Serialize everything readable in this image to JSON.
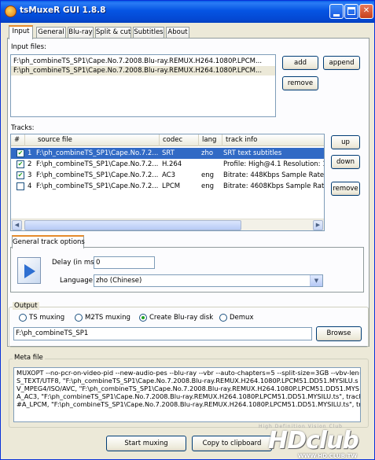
{
  "window": {
    "title": "tsMuxeR GUI 1.8.8"
  },
  "tabs": [
    "Input",
    "General",
    "Blu-ray",
    "Split & cut",
    "Subtitles",
    "About"
  ],
  "input_files": {
    "label": "Input files:",
    "files": [
      "F:\\ph_combineTS_SP1\\Cape.No.7.2008.Blu-ray.REMUX.H264.1080P.LPCM...",
      "F:\\ph_combineTS_SP1\\Cape.No.7.2008.Blu-ray.REMUX.H264.1080P.LPCM..."
    ],
    "add_label": "add",
    "append_label": "append",
    "remove_label": "remove"
  },
  "tracks": {
    "label": "Tracks:",
    "columns": [
      "#",
      "source file",
      "codec",
      "lang",
      "track info"
    ],
    "rows": [
      {
        "checked": true,
        "num": "1",
        "source": "F:\\ph_combineTS_SP1\\Cape.No.7.2...",
        "codec": "SRT",
        "lang": "zho",
        "info": "SRT text subtitles"
      },
      {
        "checked": true,
        "num": "2",
        "source": "F:\\ph_combineTS_SP1\\Cape.No.7.2...",
        "codec": "H.264",
        "lang": "",
        "info": "Profile: High@4.1  Resolution: 1920"
      },
      {
        "checked": true,
        "num": "3",
        "source": "F:\\ph_combineTS_SP1\\Cape.No.7.2...",
        "codec": "AC3",
        "lang": "eng",
        "info": "Bitrate: 448Kbps Sample Rate: 48KH"
      },
      {
        "checked": false,
        "num": "4",
        "source": "F:\\ph_combineTS_SP1\\Cape.No.7.2...",
        "codec": "LPCM",
        "lang": "eng",
        "info": "Bitrate: 4608Kbps  Sample Rate: 48"
      }
    ],
    "up_label": "up",
    "down_label": "down",
    "remove_label": "remove"
  },
  "track_options": {
    "tab_label": "General track options",
    "delay_label": "Delay (in ms):",
    "delay_value": "0",
    "language_label": "Language:",
    "language_value": "zho (Chinese)"
  },
  "output": {
    "label": "Output",
    "options": [
      "TS muxing",
      "M2TS muxing",
      "Create Blu-ray disk",
      "Demux"
    ],
    "selected": "Create Blu-ray disk",
    "path": "F:\\ph_combineTS_SP1",
    "browse_label": "Browse"
  },
  "meta": {
    "label": "Meta file",
    "lines": [
      "MUXOPT --no-pcr-on-video-pid --new-audio-pes --blu-ray --vbr  --auto-chapters=5 --split-size=3GB --vbv-len=500",
      "S_TEXT/UTF8, \"F:\\ph_combineTS_SP1\\Cape.No.7.2008.Blu-ray.REMUX.H264.1080P.LPCM51.DD51.MYSILU.s",
      "V_MPEG4/ISO/AVC, \"F:\\ph_combineTS_SP1\\Cape.No.7.2008.Blu-ray.REMUX.H264.1080P.LPCM51.DD51.MYS",
      "A_AC3, \"F:\\ph_combineTS_SP1\\Cape.No.7.2008.Blu-ray.REMUX.H264.1080P.LPCM51.DD51.MYSILU.ts\", track=",
      "#A_LPCM, \"F:\\ph_combineTS_SP1\\Cape.No.7.2008.Blu-ray.REMUX.H264.1080P.LPCM51.DD51.MYSILU.ts\", tra"
    ]
  },
  "footer": {
    "start_label": "Start muxing",
    "copy_label": "Copy to clipboard"
  },
  "watermark": {
    "tagline": "High Definition Vision Club",
    "brand": "HDclub",
    "url": "WWW.HD.CLUB.TW"
  },
  "colors": {
    "selection": "#316ac5",
    "tab_accent": "#e68b2c",
    "check": "#21a121"
  }
}
